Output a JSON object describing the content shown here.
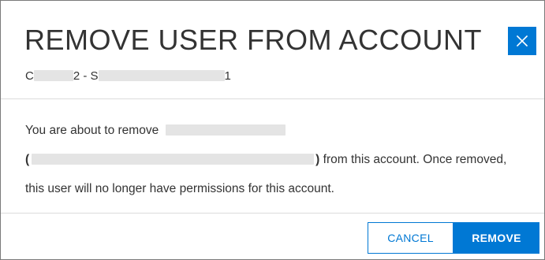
{
  "dialog": {
    "title": "REMOVE USER FROM ACCOUNT",
    "subtitle": {
      "prefix": "C",
      "middle": "2 - S",
      "suffix": "1"
    },
    "close_icon": "close-icon",
    "message": {
      "line1_prefix": "You are about to remove",
      "open_paren": "(",
      "close_paren": ")",
      "line2_suffix": " from this account. Once removed,",
      "line3": "this user will no longer have permissions for this account."
    },
    "buttons": {
      "cancel": "CANCEL",
      "remove": "REMOVE"
    }
  },
  "colors": {
    "accent": "#0078d4",
    "text": "#333333",
    "border": "#7a7a7a",
    "divider": "#dcdcdc",
    "redaction": "#e4e4e4"
  }
}
